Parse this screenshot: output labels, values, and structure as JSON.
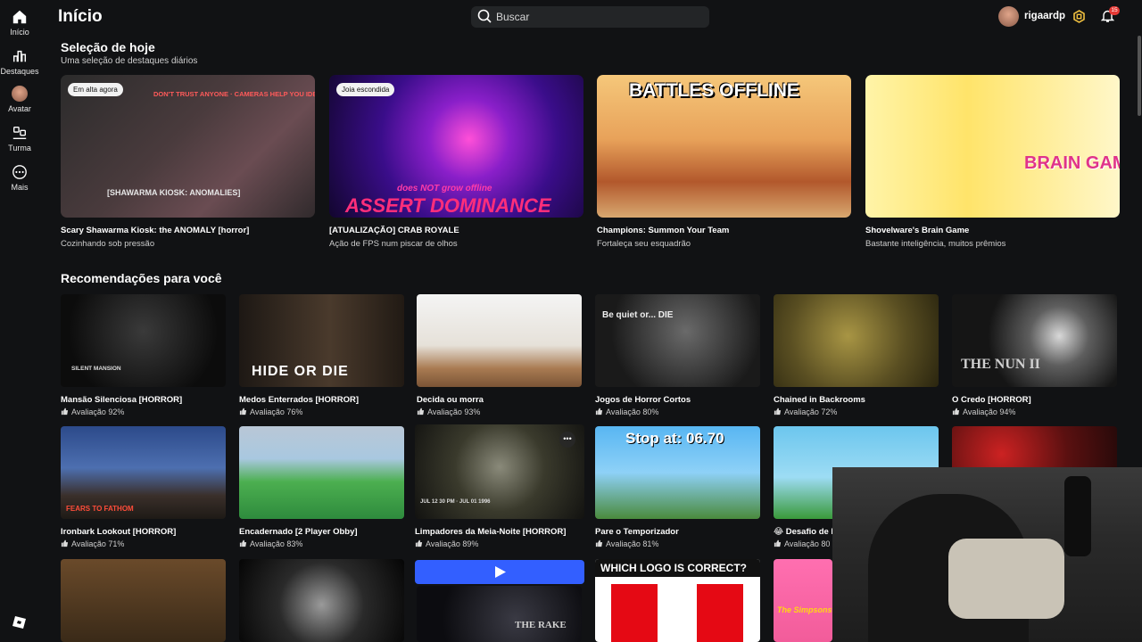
{
  "sidebar": {
    "items": [
      {
        "label": "Início",
        "icon": "home-icon"
      },
      {
        "label": "Destaques",
        "icon": "chart-icon"
      },
      {
        "label": "Avatar",
        "icon": "avatar-icon"
      },
      {
        "label": "Turma",
        "icon": "people-icon"
      },
      {
        "label": "Mais",
        "icon": "more-icon"
      }
    ],
    "logo": "roblox-logo-icon"
  },
  "header": {
    "title": "Início",
    "search_placeholder": "Buscar",
    "username": "rigaardp",
    "notification_count": "15"
  },
  "featured": {
    "title": "Seleção de hoje",
    "subtitle": "Uma seleção de destaques diários",
    "items": [
      {
        "name": "Scary Shawarma Kiosk: the ANOMALY [horror]",
        "sub": "Cozinhando sob pressão",
        "chip": "Em alta agora",
        "art_text": "DON'T TRUST ANYONE · CAMERAS HELP YOU IDENTIFY ANOMALIES",
        "art_text2": "[SHAWARMA KIOSK: ANOMALIES]"
      },
      {
        "name": "[ATUALIZAÇÃO] CRAB ROYALE",
        "sub": "Ação de FPS num piscar de olhos",
        "chip": "Joia escondida",
        "art_text": "ASSERT DOMINANCE",
        "art_text2": "does NOT grow offline"
      },
      {
        "name": "Champions: Summon Your Team",
        "sub": "Fortaleça seu esquadrão",
        "chip": "",
        "art_text": "BATTLES OFFLINE",
        "art_text2": ""
      },
      {
        "name": "Shovelware's Brain Game",
        "sub": "Bastante inteligência, muitos prêmios",
        "chip": "",
        "art_text": "BRAIN GAME",
        "art_text2": ""
      }
    ]
  },
  "recommendations": {
    "title": "Recomendações para você",
    "items": [
      {
        "name": "Mansão Silenciosa [HORROR]",
        "rating": "Avaliação 92%",
        "art_text": "SILENT MANSION"
      },
      {
        "name": "Medos Enterrados [HORROR]",
        "rating": "Avaliação 76%",
        "art_text": "HIDE OR DIE"
      },
      {
        "name": "Decida ou morra",
        "rating": "Avaliação 93%",
        "art_text": ""
      },
      {
        "name": "Jogos de Horror Cortos",
        "rating": "Avaliação 80%",
        "art_text": "Be quiet or... DIE"
      },
      {
        "name": "Chained in Backrooms",
        "rating": "Avaliação 72%",
        "art_text": ""
      },
      {
        "name": "O Credo [HORROR]",
        "rating": "Avaliação 94%",
        "art_text": "THE NUN II"
      },
      {
        "name": "Ironbark Lookout [HORROR]",
        "rating": "Avaliação 71%",
        "art_text": "FEARS TO FATHOM"
      },
      {
        "name": "Encadernado [2 Player Obby]",
        "rating": "Avaliação 83%",
        "art_text": ""
      },
      {
        "name": "Limpadores da Meia-Noite [HORROR]",
        "rating": "Avaliação 89%",
        "art_text": "JUL 12 30 PM · JUL 01 1996"
      },
      {
        "name": "Pare o Temporizador",
        "rating": "Avaliação 81%",
        "art_text": "Stop at: 06.70"
      },
      {
        "name": "😂 Desafio de M",
        "rating": "Avaliação 80",
        "art_text": ""
      },
      {
        "name": "",
        "rating": "",
        "art_text": ""
      },
      {
        "name": "",
        "rating": "",
        "art_text": ""
      },
      {
        "name": "",
        "rating": "",
        "art_text": ""
      },
      {
        "name": "",
        "rating": "",
        "art_text": "THE RAKE"
      },
      {
        "name": "",
        "rating": "",
        "art_text": "WHICH LOGO IS CORRECT?"
      },
      {
        "name": "",
        "rating": "",
        "art_text": "The Simpsons"
      }
    ]
  },
  "colors": {
    "background": "#111214",
    "accent": "#335fff",
    "badge": "#e53935"
  }
}
